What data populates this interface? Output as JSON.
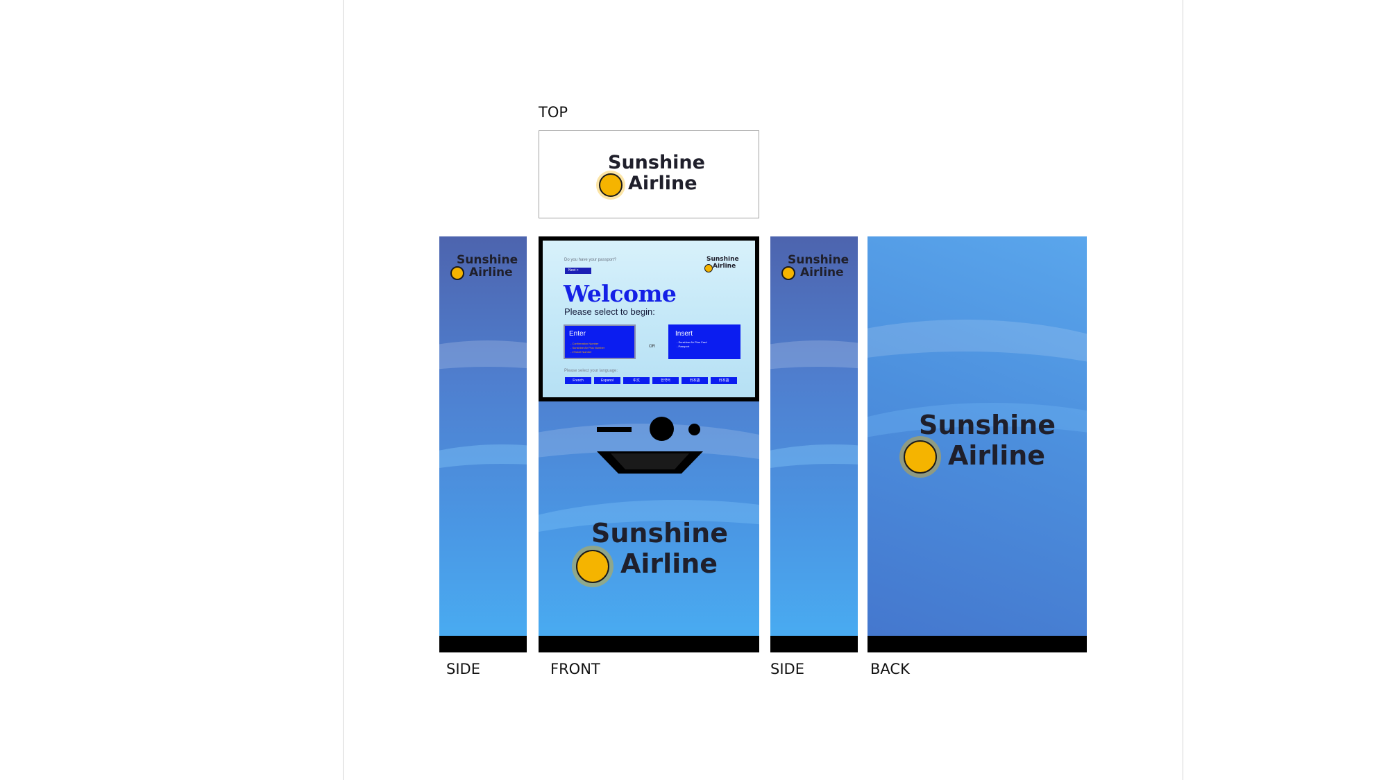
{
  "views": {
    "top": "TOP",
    "side_left": "SIDE",
    "front": "FRONT",
    "side_right": "SIDE",
    "back": "BACK"
  },
  "brand": {
    "line1": "Sunshine",
    "line2": "Airline",
    "sun_color": "#f5b400",
    "text_color": "#1f1f2b",
    "panel_blue": "#4a8fe0"
  },
  "kiosk_screen": {
    "question": "Do you have your passport?",
    "next_button": "Next >",
    "welcome": "Welcome",
    "instruction": "Please select to begin:",
    "enter_box": {
      "title": "Enter",
      "items": [
        "- Confirmation Number",
        "- Sunshine Air Plus Number",
        "- eTicket Number"
      ]
    },
    "or_text": "OR",
    "insert_box": {
      "title": "Insert",
      "items": [
        "- Sunshine Air Plus Card",
        "- Passport"
      ]
    },
    "language_prompt": "Please select your language:",
    "languages": [
      "French",
      "Espanol",
      "中文",
      "한국어",
      "日本語",
      "日本語"
    ],
    "accent_color": "#0b1df0"
  }
}
